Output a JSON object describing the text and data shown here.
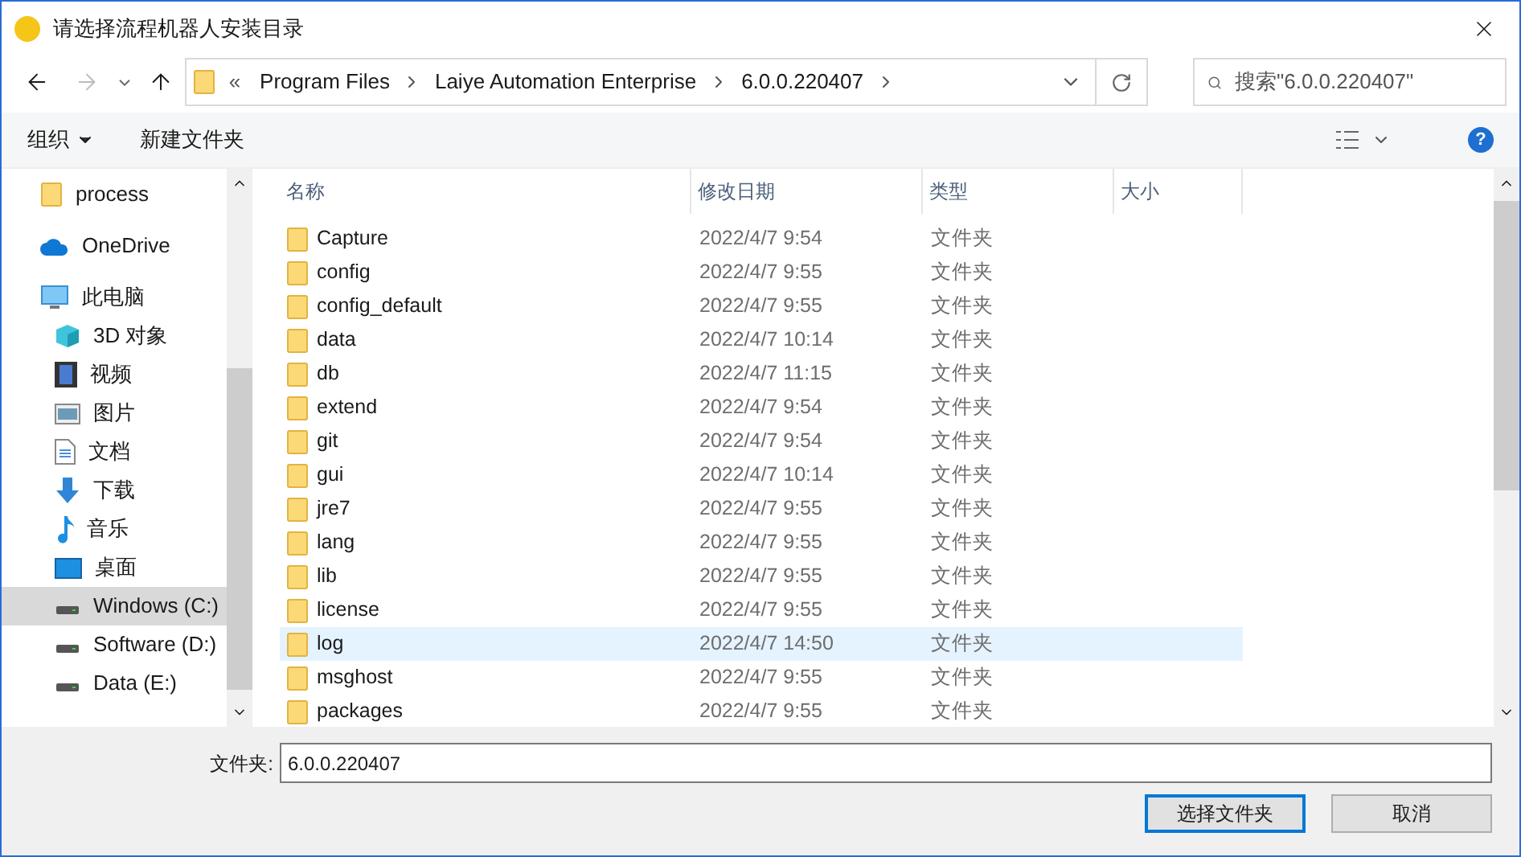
{
  "window": {
    "title": "请选择流程机器人安装目录"
  },
  "address_bar": {
    "overflow": "«",
    "crumbs": [
      "Program Files",
      "Laiye Automation Enterprise",
      "6.0.0.220407"
    ]
  },
  "search": {
    "placeholder": "搜索\"6.0.0.220407\""
  },
  "toolbar": {
    "organize": "组织",
    "new_folder": "新建文件夹",
    "help": "?"
  },
  "sidebar": {
    "items": [
      {
        "label": "process",
        "kind": "folder",
        "selected": false
      },
      {
        "label": "OneDrive",
        "kind": "cloud",
        "selected": false
      },
      {
        "label": "此电脑",
        "kind": "pc",
        "selected": false,
        "children": [
          {
            "label": "3D 对象",
            "kind": "cube",
            "selected": false
          },
          {
            "label": "视频",
            "kind": "video",
            "selected": false
          },
          {
            "label": "图片",
            "kind": "picture",
            "selected": false
          },
          {
            "label": "文档",
            "kind": "document",
            "selected": false
          },
          {
            "label": "下载",
            "kind": "download",
            "selected": false
          },
          {
            "label": "音乐",
            "kind": "music",
            "selected": false
          },
          {
            "label": "桌面",
            "kind": "desktop",
            "selected": false
          },
          {
            "label": "Windows (C:)",
            "kind": "drive",
            "selected": true
          },
          {
            "label": "Software (D:)",
            "kind": "drive",
            "selected": false
          },
          {
            "label": "Data (E:)",
            "kind": "drive",
            "selected": false
          }
        ]
      }
    ]
  },
  "table": {
    "columns": [
      "名称",
      "修改日期",
      "类型",
      "大小"
    ],
    "rows": [
      {
        "name": "Capture",
        "date": "2022/4/7 9:54",
        "type": "文件夹",
        "selected": false
      },
      {
        "name": "config",
        "date": "2022/4/7 9:55",
        "type": "文件夹",
        "selected": false
      },
      {
        "name": "config_default",
        "date": "2022/4/7 9:55",
        "type": "文件夹",
        "selected": false
      },
      {
        "name": "data",
        "date": "2022/4/7 10:14",
        "type": "文件夹",
        "selected": false
      },
      {
        "name": "db",
        "date": "2022/4/7 11:15",
        "type": "文件夹",
        "selected": false
      },
      {
        "name": "extend",
        "date": "2022/4/7 9:54",
        "type": "文件夹",
        "selected": false
      },
      {
        "name": "git",
        "date": "2022/4/7 9:54",
        "type": "文件夹",
        "selected": false
      },
      {
        "name": "gui",
        "date": "2022/4/7 10:14",
        "type": "文件夹",
        "selected": false
      },
      {
        "name": "jre7",
        "date": "2022/4/7 9:55",
        "type": "文件夹",
        "selected": false
      },
      {
        "name": "lang",
        "date": "2022/4/7 9:55",
        "type": "文件夹",
        "selected": false
      },
      {
        "name": "lib",
        "date": "2022/4/7 9:55",
        "type": "文件夹",
        "selected": false
      },
      {
        "name": "license",
        "date": "2022/4/7 9:55",
        "type": "文件夹",
        "selected": false
      },
      {
        "name": "log",
        "date": "2022/4/7 14:50",
        "type": "文件夹",
        "selected": true
      },
      {
        "name": "msghost",
        "date": "2022/4/7 9:55",
        "type": "文件夹",
        "selected": false
      },
      {
        "name": "packages",
        "date": "2022/4/7 9:55",
        "type": "文件夹",
        "selected": false
      }
    ]
  },
  "folder_field": {
    "label": "文件夹:",
    "value": "6.0.0.220407"
  },
  "buttons": [
    {
      "label": "选择文件夹",
      "kind": "primary"
    },
    {
      "label": "取消",
      "kind": "secondary"
    }
  ]
}
